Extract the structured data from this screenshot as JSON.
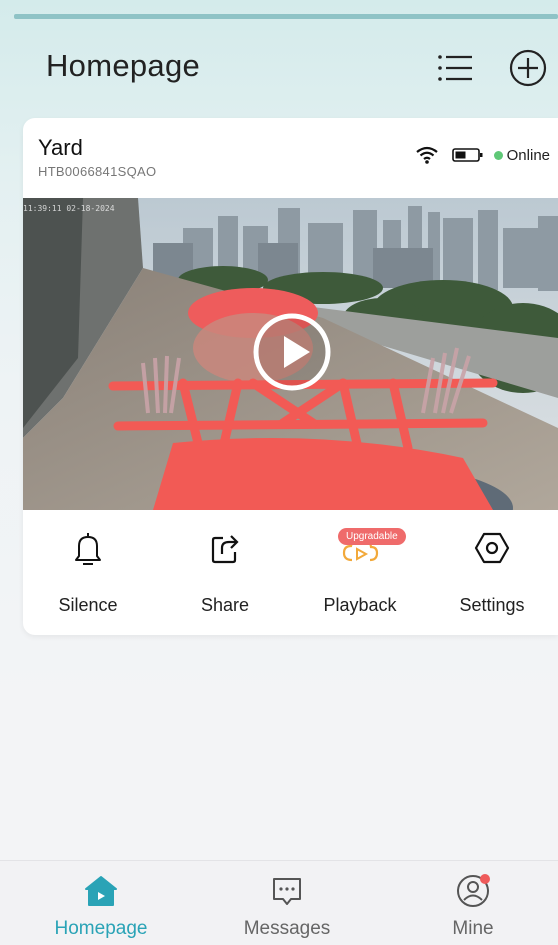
{
  "header": {
    "title": "Homepage",
    "list_icon": "list-icon",
    "add_icon": "add-circle-icon"
  },
  "device": {
    "name": "Yard",
    "id": "HTB0066841SQAO",
    "status": "Online",
    "status_color": "#5fc877",
    "wifi_icon": "wifi-icon",
    "battery_icon": "battery-icon",
    "video_timestamp": "11:39:11 02-18-2024"
  },
  "actions": [
    {
      "label": "Silence",
      "icon": "bell-icon"
    },
    {
      "label": "Share",
      "icon": "share-icon"
    },
    {
      "label": "Playback",
      "icon": "playback-cloud-icon",
      "badge": "Upgradable"
    },
    {
      "label": "Settings",
      "icon": "settings-hexagon-icon"
    }
  ],
  "tabs": [
    {
      "label": "Homepage",
      "icon": "home-icon",
      "active": true
    },
    {
      "label": "Messages",
      "icon": "message-icon"
    },
    {
      "label": "Mine",
      "icon": "user-icon",
      "has_notification": true
    }
  ],
  "colors": {
    "accent": "#2aa3b6",
    "badge": "#ef6b6b",
    "playback_icon": "#f2a93b"
  }
}
